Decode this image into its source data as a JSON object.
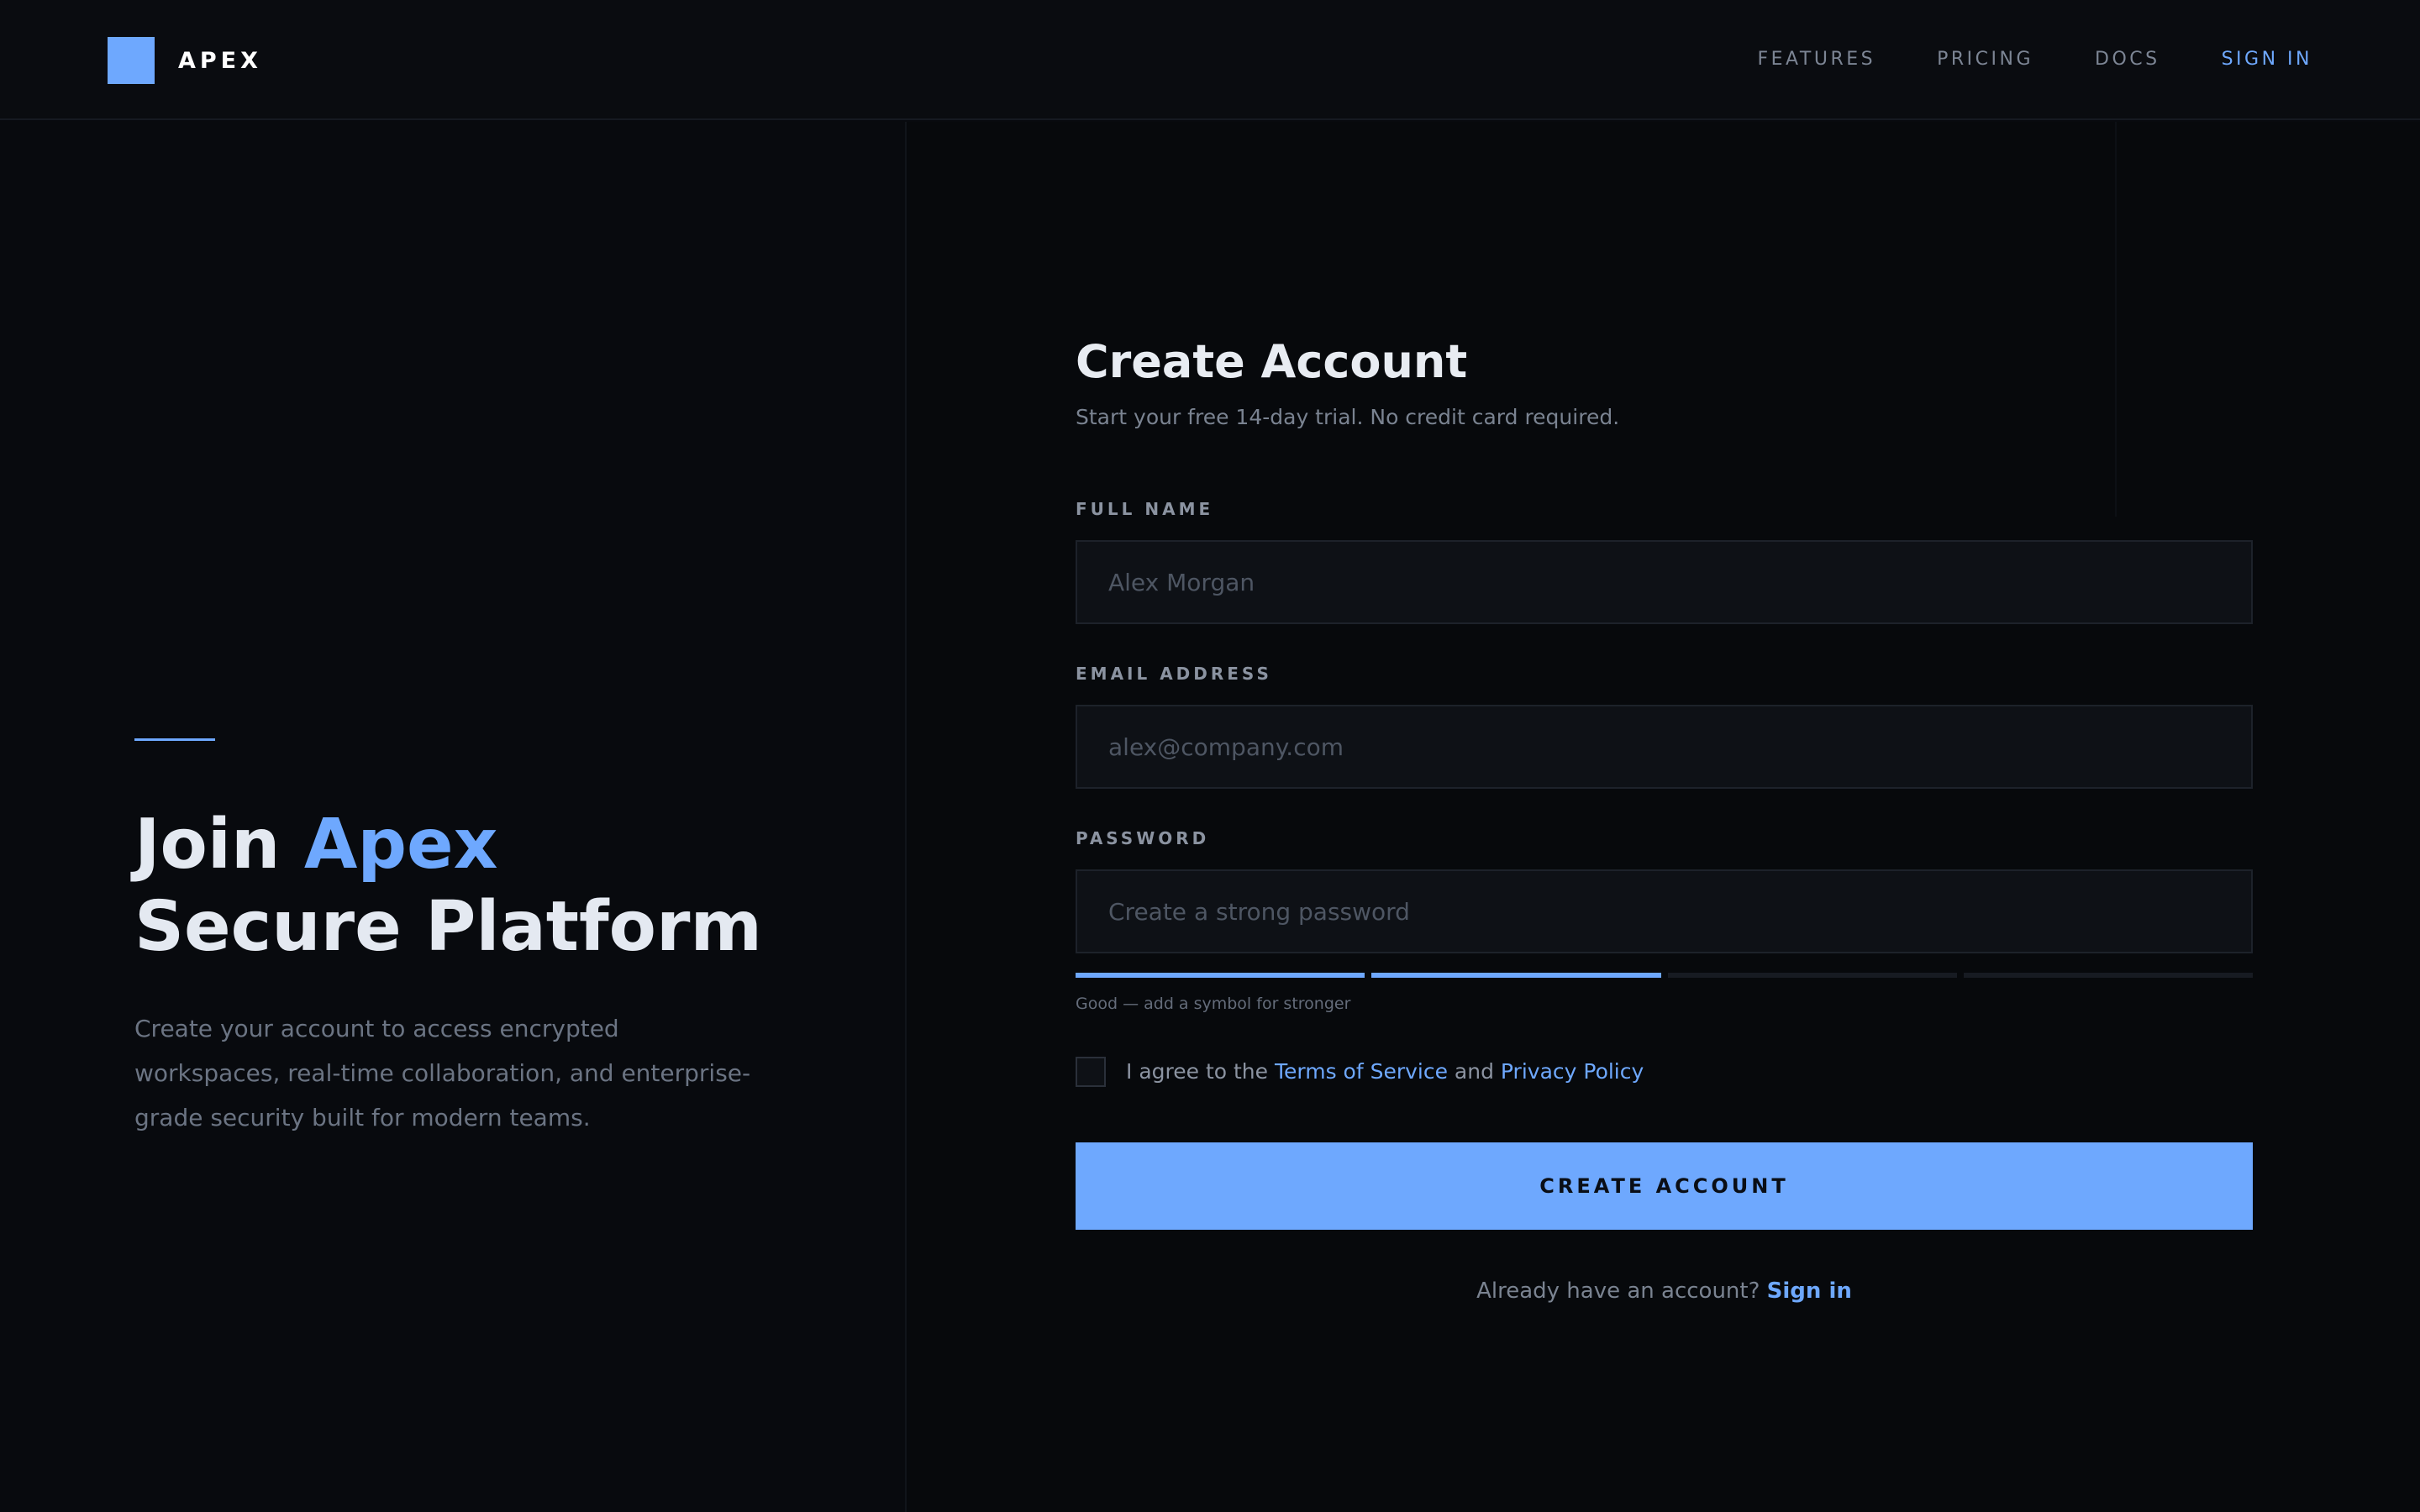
{
  "header": {
    "brand": "APEX",
    "nav": [
      {
        "label": "FEATURES"
      },
      {
        "label": "PRICING"
      },
      {
        "label": "DOCS"
      },
      {
        "label": "SIGN IN"
      }
    ]
  },
  "hero": {
    "title_word1": "Join ",
    "title_accent": "Apex",
    "title_line2": "Secure Platform",
    "body": "Create your account to access encrypted workspaces, real-time collaboration, and enterprise-grade security built for modern teams."
  },
  "form": {
    "title": "Create Account",
    "subtitle": "Start your free 14-day trial. No credit card required.",
    "full_name": {
      "label": "FULL NAME",
      "placeholder": "Alex Morgan",
      "value": ""
    },
    "email": {
      "label": "EMAIL ADDRESS",
      "placeholder": "alex@company.com",
      "value": ""
    },
    "password": {
      "label": "PASSWORD",
      "placeholder": "Create a strong password",
      "value": ""
    },
    "strength": {
      "filled": 2,
      "total": 4,
      "hint": "Good — add a symbol for stronger"
    },
    "agree": {
      "prefix": "I agree to the ",
      "terms": "Terms of Service",
      "middle": " and ",
      "privacy": "Privacy Policy",
      "checked": false
    },
    "submit_label": "CREATE ACCOUNT",
    "signin_prompt": "Already have an account? ",
    "signin_link": "Sign in"
  },
  "colors": {
    "accent": "#6ea8fe",
    "background": "#080a0e"
  }
}
